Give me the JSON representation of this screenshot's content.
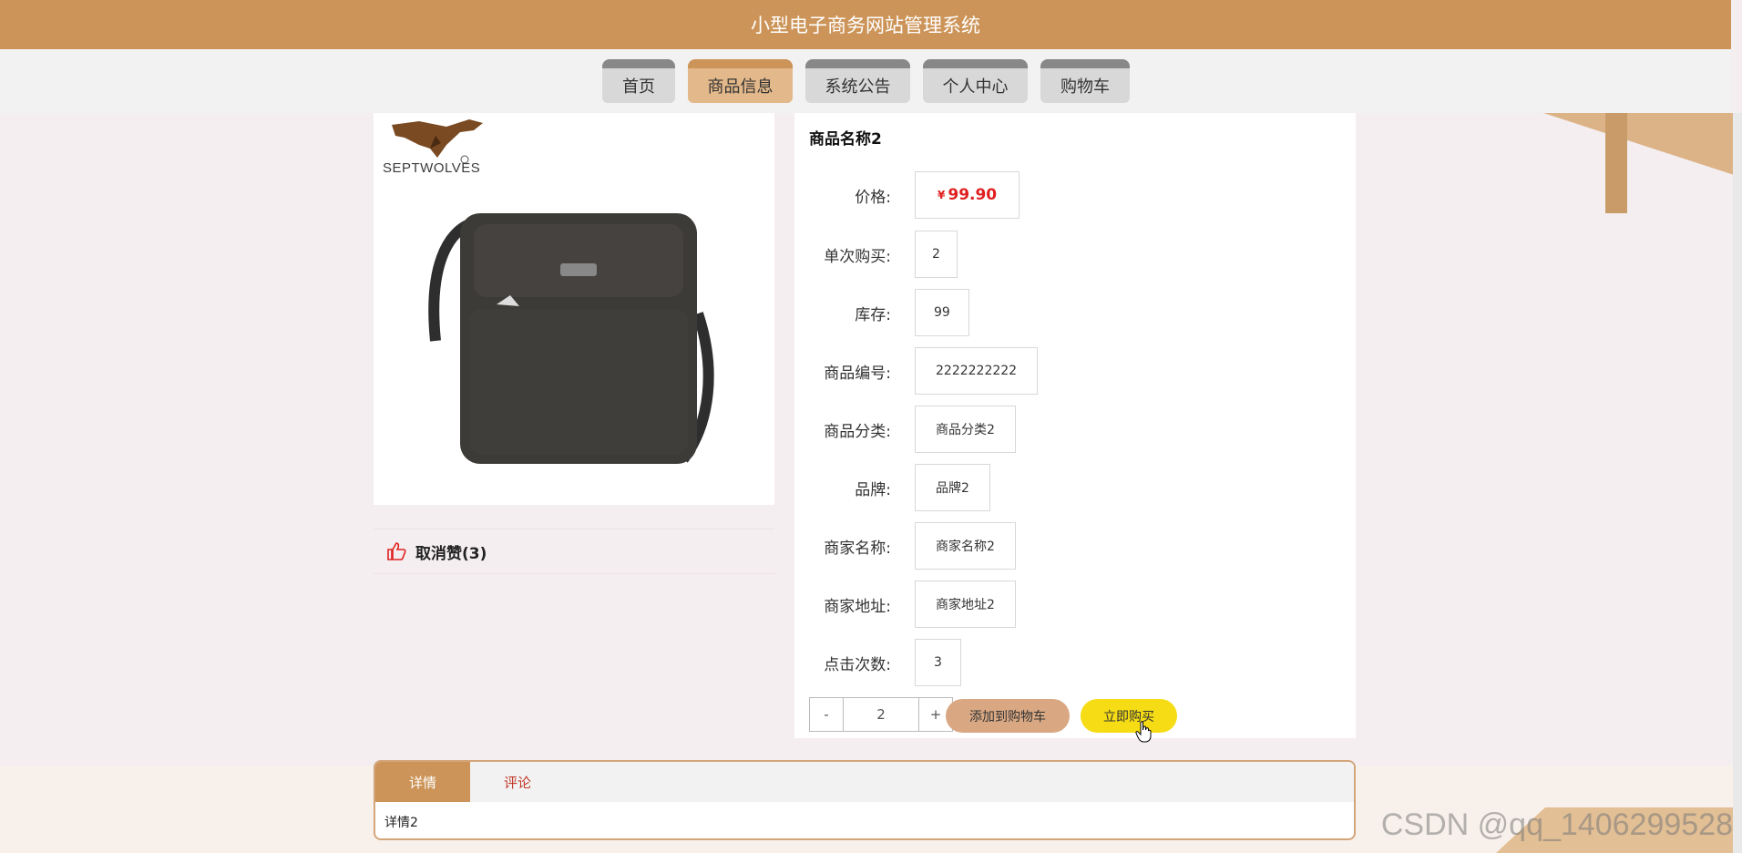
{
  "header": {
    "title": "小型电子商务网站管理系统"
  },
  "nav": {
    "items": [
      {
        "label": "首页",
        "active": false
      },
      {
        "label": "商品信息",
        "active": true
      },
      {
        "label": "系统公告",
        "active": false
      },
      {
        "label": "个人中心",
        "active": false
      },
      {
        "label": "购物车",
        "active": false
      }
    ]
  },
  "product": {
    "brand_logo_text": "SEPTWOLVES",
    "like_label": "取消赞(3)",
    "name": "商品名称2",
    "fields": {
      "price": {
        "label": "价格:",
        "currency": "¥",
        "value": "99.90"
      },
      "single_purchase": {
        "label": "单次购买:",
        "value": "2"
      },
      "stock": {
        "label": "库存:",
        "value": "99"
      },
      "code": {
        "label": "商品编号:",
        "value": "2222222222"
      },
      "category": {
        "label": "商品分类:",
        "value": "商品分类2"
      },
      "brand": {
        "label": "品牌:",
        "value": "品牌2"
      },
      "merchant_name": {
        "label": "商家名称:",
        "value": "商家名称2"
      },
      "merchant_address": {
        "label": "商家地址:",
        "value": "商家地址2"
      },
      "clicks": {
        "label": "点击次数:",
        "value": "3"
      }
    },
    "quantity": {
      "minus": "-",
      "value": "2",
      "plus": "+"
    },
    "add_to_cart_label": "添加到购物车",
    "buy_now_label": "立即购买"
  },
  "tabs": {
    "items": [
      {
        "label": "详情",
        "active": true
      },
      {
        "label": "评论",
        "active": false
      }
    ],
    "content": "详情2"
  },
  "watermark": "CSDN @qq_1406299528",
  "colors": {
    "header": "#cc9458",
    "active_nav": "#e3b88a",
    "price": "#e02020",
    "add_to_cart": "#d9a883",
    "buy_now": "#f5dc14"
  }
}
